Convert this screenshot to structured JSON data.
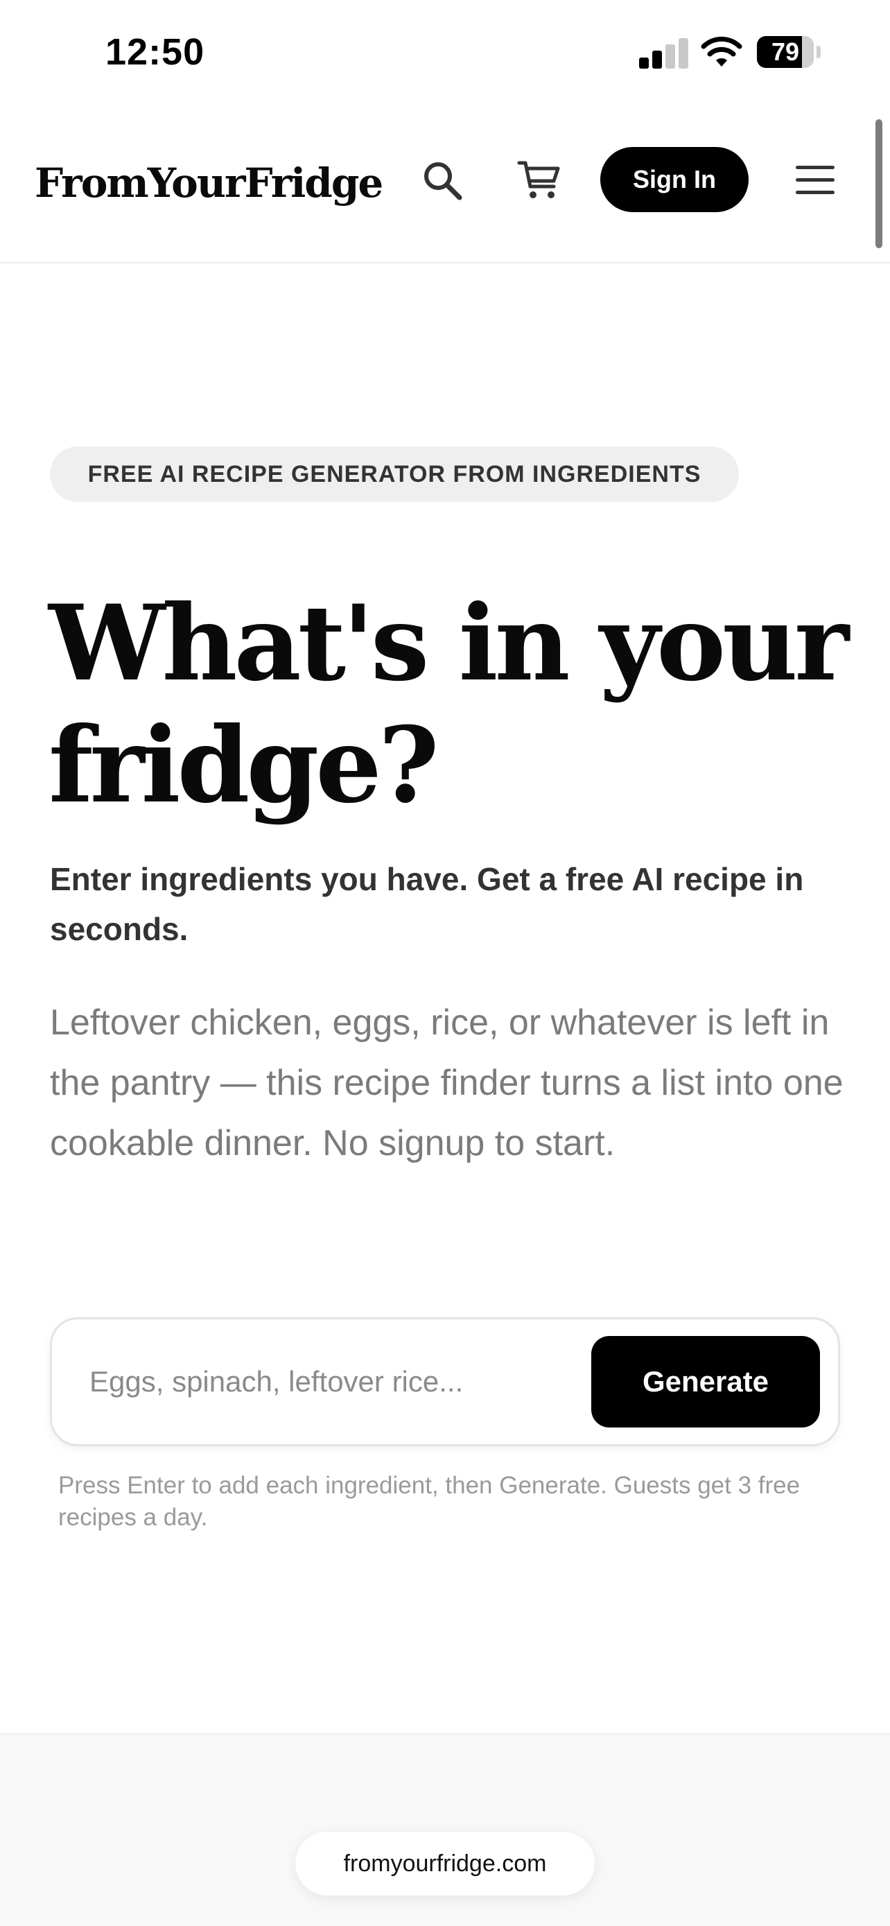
{
  "status_bar": {
    "time": "12:50",
    "battery_percent": "79",
    "battery_level": 0.79,
    "signal_bars_active": 2,
    "signal_bars_total": 4
  },
  "header": {
    "logo": "FromYourFridge",
    "search_icon": "search-icon",
    "cart_icon": "cart-icon",
    "sign_in_label": "Sign In",
    "menu_icon": "hamburger-menu-icon"
  },
  "hero": {
    "badge": "FREE AI RECIPE GENERATOR FROM INGREDIENTS",
    "title_line1": "What's in your",
    "title_line2": "fridge?",
    "subtitle": "Enter ingredients you have. Get a free AI recipe in seconds.",
    "description": "Leftover chicken, eggs, rice, or whatever is left in the pantry — this recipe finder turns a list into one cookable dinner. No signup to start."
  },
  "form": {
    "input_value": "",
    "input_placeholder": "Eggs, spinach, leftover rice...",
    "generate_label": "Generate",
    "hint": "Press Enter to add each ingredient, then Generate. Guests get 3 free recipes a day."
  },
  "browser": {
    "url": "fromyourfridge.com"
  },
  "colors": {
    "primary": "#000000",
    "badge_bg": "#efefef",
    "muted_text": "#7b7b7b"
  }
}
